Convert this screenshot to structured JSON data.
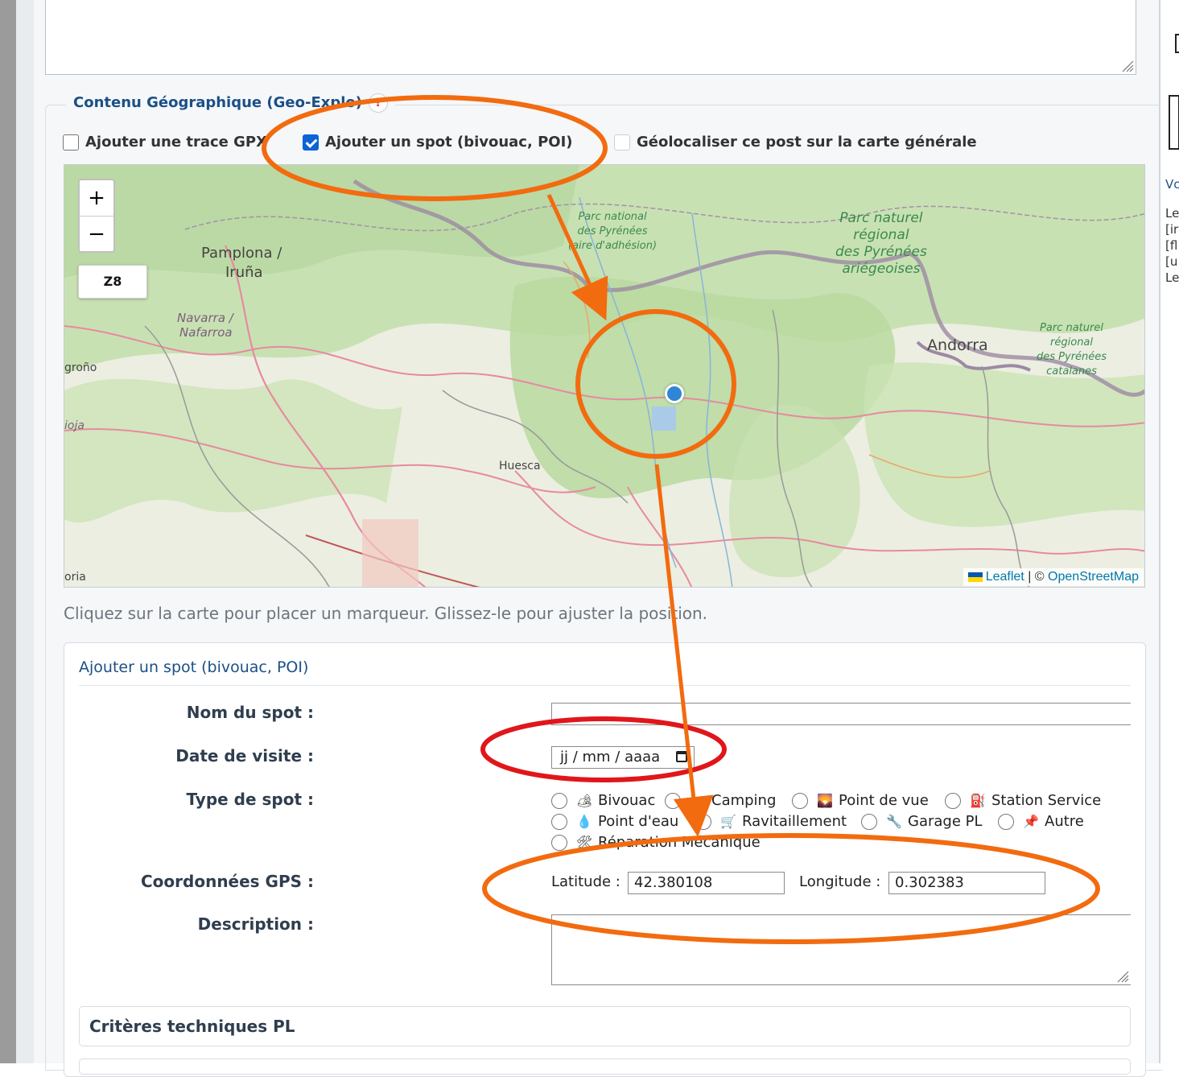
{
  "section": {
    "legend": "Contenu Géographique (Geo-Explo)",
    "help": "?"
  },
  "options": [
    {
      "label": "Ajouter une trace GPX",
      "checked": false
    },
    {
      "label": "Ajouter un spot (bivouac, POI)",
      "checked": true
    },
    {
      "label": "Géolocaliser ce post sur la carte générale",
      "checked": false
    }
  ],
  "map": {
    "zoom_in": "+",
    "zoom_out": "−",
    "zoom_level": "Z8",
    "attribution": {
      "leaflet": "Leaflet",
      "sep": "| ©",
      "osm": "OpenStreetMap"
    },
    "labels": {
      "pamplona": "Pamplona /",
      "iruna": "Iruña",
      "navarra": "Navarra /",
      "nafarroa": "Nafarroa",
      "logrono": "groño",
      "rioja": "ioja",
      "huesca": "Huesca",
      "soria": "oria",
      "andorra": "Andorra",
      "parc_national": "Parc national\ndes Pyrénées\n(aire d'adhésion)",
      "parc_ariege": "Parc naturel\nrégional\ndes Pyrénées\nariégeoises",
      "parc_catalanes": "Parc naturel\nrégional\ndes Pyrénées\ncatalanes"
    }
  },
  "hint": "Cliquez sur la carte pour placer un marqueur. Glissez-le pour ajuster la position.",
  "spot_form": {
    "title": "Ajouter un spot (bivouac, POI)",
    "name_label": "Nom du spot :",
    "date_label": "Date de visite :",
    "date_placeholder": "jj / mm / aaaa",
    "type_label": "Type de spot :",
    "types": [
      {
        "icon": "🏕",
        "label": "Bivouac"
      },
      {
        "icon": "⛺",
        "label": "Camping"
      },
      {
        "icon": "🌄",
        "label": "Point de vue"
      },
      {
        "icon": "⛽",
        "label": "Station Service"
      },
      {
        "icon": "💧",
        "label": "Point d'eau"
      },
      {
        "icon": "🛒",
        "label": "Ravitaillement"
      },
      {
        "icon": "🔧",
        "label": "Garage PL"
      },
      {
        "icon": "📌",
        "label": "Autre"
      },
      {
        "icon": "🛠",
        "label": "Réparation Mécanique"
      }
    ],
    "gps_label": "Coordonnées GPS :",
    "lat_label": "Latitude :",
    "lat_value": "42.380108",
    "lon_label": "Longitude :",
    "lon_value": "0.302383",
    "desc_label": "Description :"
  },
  "accordion": {
    "title": "Critères techniques PL"
  },
  "right_panel": [
    "Vc",
    "Le",
    "[ir",
    "[fl",
    "[u",
    "Le"
  ],
  "colors": {
    "annotation_orange": "#f26b0f",
    "annotation_red": "#e0161b",
    "link_blue": "#1b4f86",
    "checkbox_blue": "#0b63d6"
  }
}
